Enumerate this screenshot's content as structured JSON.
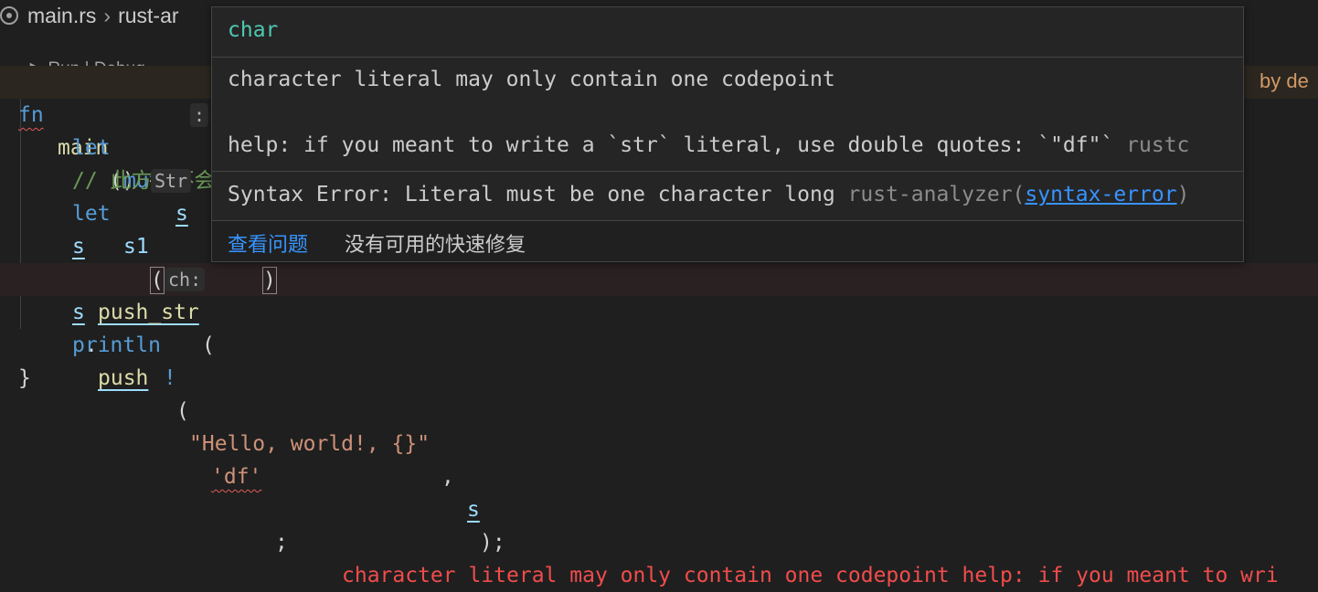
{
  "breadcrumb": {
    "file": "main.rs",
    "symbol": "rust-ar"
  },
  "codelens": {
    "run": "Run",
    "separator": "|",
    "debug": "Debug"
  },
  "code": {
    "l1": {
      "kw": "fn",
      "name": "main",
      "rest": "() {"
    },
    "l2": {
      "kw1": "let",
      "kw2": "mut",
      "var": "s",
      "colon": ":"
    },
    "l3": {
      "comment": "// 此方法不会"
    },
    "l4": {
      "kw": "let",
      "var": "s1",
      "hint": "Str"
    },
    "l5": {
      "var": "s",
      "dot": ".",
      "method": "push_str",
      "paren": "("
    },
    "l7": {
      "var": "s",
      "dot": ".",
      "method": "push",
      "open": "(",
      "hint": "ch:",
      "literal": "'df'",
      "close": ")",
      "semi": ";",
      "error": "character literal may only contain one codepoint help: if you meant to wri"
    },
    "l8": {
      "macro": "println",
      "bang": "!",
      "open": "(",
      "fmt": "\"Hello, world!, {}\"",
      "comma": ", ",
      "arg": "s",
      "close": ");"
    },
    "l9": {
      "brace": "}"
    }
  },
  "blame": "by de",
  "hover": {
    "type": "char",
    "message1": "character literal may only contain one codepoint",
    "message2": "help: if you meant to write a `str` literal, use double quotes: `\"df\"`",
    "source1": "rustc",
    "syntax_msg": "Syntax Error: Literal must be one character long",
    "source2_prefix": "rust-analyzer(",
    "source2_link": "syntax-error",
    "source2_suffix": ")",
    "action_view": "查看问题",
    "action_fix": "没有可用的快速修复"
  },
  "colors": {
    "keyword": "#569cd6",
    "function": "#dcdcaa",
    "variable": "#9cdcfe",
    "string": "#ce9178",
    "comment": "#6a9955",
    "error": "#f14c4c",
    "type": "#4ec9b0",
    "link": "#3794ff"
  },
  "icons": [
    "rust-file-icon",
    "lightbulb-icon"
  ]
}
